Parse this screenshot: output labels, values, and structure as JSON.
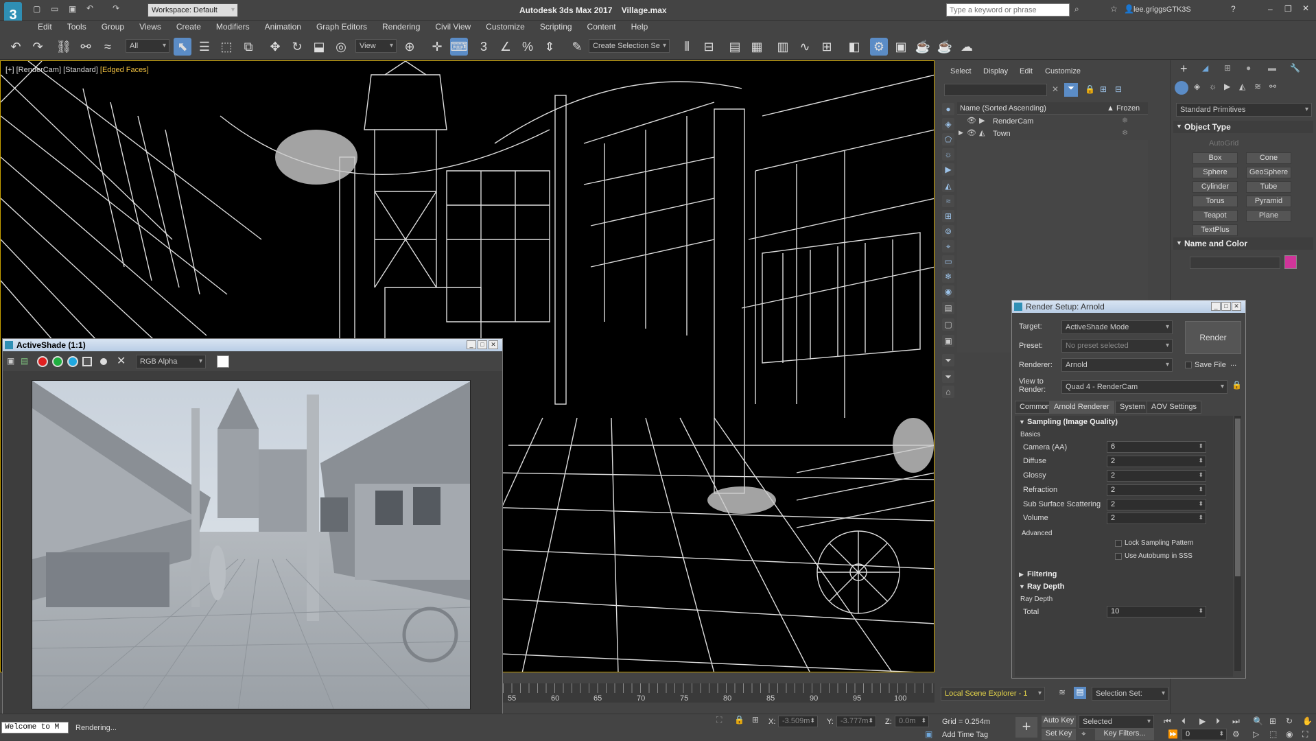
{
  "app": {
    "title": "Autodesk 3ds Max 2017",
    "file": "Village.max",
    "workspace": "Workspace: Default",
    "search_placeholder": "Type a keyword or phrase",
    "user": "lee.griggsGTK3S"
  },
  "menu": [
    "Edit",
    "Tools",
    "Group",
    "Views",
    "Create",
    "Modifiers",
    "Animation",
    "Graph Editors",
    "Rendering",
    "Civil View",
    "Customize",
    "Scripting",
    "Content",
    "Help"
  ],
  "toolbar": {
    "filter": "All",
    "refcoord": "View",
    "selset": "Create Selection Se"
  },
  "viewport": {
    "label_a": "[+] [RenderCam] [Standard] ",
    "label_b": "[Edged Faces]"
  },
  "timeline": {
    "ticks": [
      "55",
      "60",
      "65",
      "70",
      "75",
      "80",
      "85",
      "90",
      "95",
      "100"
    ]
  },
  "activeshade": {
    "title": "ActiveShade (1:1)",
    "channel": "RGB Alpha"
  },
  "explorer": {
    "menu": [
      "Select",
      "Display",
      "Edit",
      "Customize"
    ],
    "col_name": "Name (Sorted Ascending)",
    "col_frozen": "▲ Frozen",
    "items": [
      "RenderCam",
      "Town"
    ],
    "footer": "Local Scene Explorer - 1",
    "selset_label": "Selection Set:"
  },
  "cmdpanel": {
    "category": "Standard Primitives",
    "rollout_type": "Object Type",
    "autogrid": "AutoGrid",
    "primitives": [
      "Box",
      "Cone",
      "Sphere",
      "GeoSphere",
      "Cylinder",
      "Tube",
      "Torus",
      "Pyramid",
      "Teapot",
      "Plane",
      "TextPlus"
    ],
    "rollout_name": "Name and Color",
    "swatch": "#d0359a"
  },
  "render_setup": {
    "title": "Render Setup: Arnold",
    "target_label": "Target:",
    "target": "ActiveShade Mode",
    "preset_label": "Preset:",
    "preset": "No preset selected",
    "renderer_label": "Renderer:",
    "renderer": "Arnold",
    "savefile": "Save File",
    "view_label": "View to\nRender:",
    "view": "Quad 4 - RenderCam",
    "render_btn": "Render",
    "more": "...",
    "tabs": [
      "Common",
      "Arnold Renderer",
      "System",
      "AOV Settings"
    ],
    "sampling_title": "Sampling (Image Quality)",
    "basics": "Basics",
    "params": [
      {
        "label": "Camera (AA)",
        "value": "6"
      },
      {
        "label": "Diffuse",
        "value": "2"
      },
      {
        "label": "Glossy",
        "value": "2"
      },
      {
        "label": "Refraction",
        "value": "2"
      },
      {
        "label": "Sub Surface Scattering",
        "value": "2"
      },
      {
        "label": "Volume",
        "value": "2"
      }
    ],
    "advanced": "Advanced",
    "lock_sampling": "Lock Sampling Pattern",
    "autobump": "Use Autobump in SSS",
    "filtering": "Filtering",
    "raydepth": "Ray Depth",
    "raydepth_sub": "Ray Depth",
    "total_label": "Total",
    "total": "10"
  },
  "status": {
    "welcome": "Welcome to M",
    "rendering": "Rendering...",
    "x_label": "X:",
    "x": "-3.509m",
    "y_label": "Y:",
    "y": "-3.777m",
    "z_label": "Z:",
    "z": "0.0m",
    "grid": "Grid = 0.254m",
    "add_time_tag": "Add Time Tag",
    "auto_key": "Auto Key",
    "set_key": "Set Key",
    "key_mode": "Selected",
    "key_filters": "Key Filters...",
    "frame": "0"
  }
}
